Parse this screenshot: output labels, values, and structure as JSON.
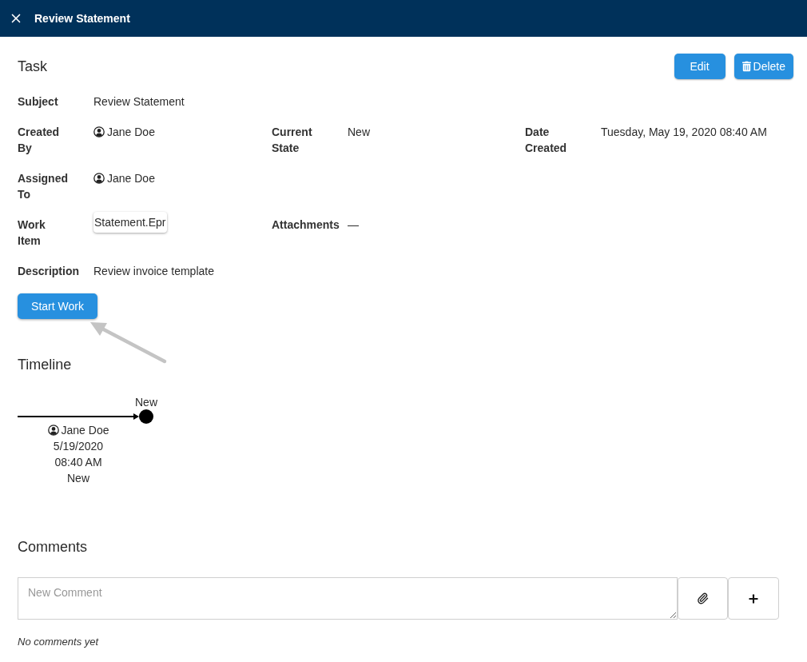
{
  "header": {
    "title": "Review Statement"
  },
  "task": {
    "title": "Task",
    "actions": [
      {
        "kind": "edit",
        "label": "Edit"
      },
      {
        "kind": "delete",
        "label": "Delete"
      }
    ],
    "rows": [
      [
        {
          "label": "Subject",
          "value": "Review Statement",
          "kind": "text"
        }
      ],
      [
        {
          "label": "Created By",
          "value": "Jane Doe",
          "kind": "user"
        },
        {
          "label": "Current State",
          "value": "New",
          "kind": "text"
        },
        {
          "label": "Date Created",
          "value": "Tuesday, May 19, 2020 08:40 AM",
          "kind": "text"
        }
      ],
      [
        {
          "label": "Assigned To",
          "value": "Jane Doe",
          "kind": "user"
        }
      ],
      [
        {
          "label": "Work Item",
          "value": "Statement.Epr",
          "kind": "chip"
        },
        {
          "label": "Attachments",
          "value": "—",
          "kind": "text"
        }
      ],
      [
        {
          "label": "Description",
          "value": "Review invoice template",
          "kind": "text"
        }
      ]
    ],
    "primary_action": {
      "label": "Start Work"
    }
  },
  "timeline": {
    "title": "Timeline",
    "events": [
      {
        "state": "New",
        "user": "Jane Doe",
        "date": "5/19/2020",
        "time": "08:40 AM",
        "status": "New"
      }
    ]
  },
  "comments": {
    "title": "Comments",
    "input": {
      "placeholder": "New Comment"
    },
    "actions": [
      {
        "kind": "attach"
      },
      {
        "kind": "add"
      }
    ],
    "empty_text": "No comments yet"
  }
}
